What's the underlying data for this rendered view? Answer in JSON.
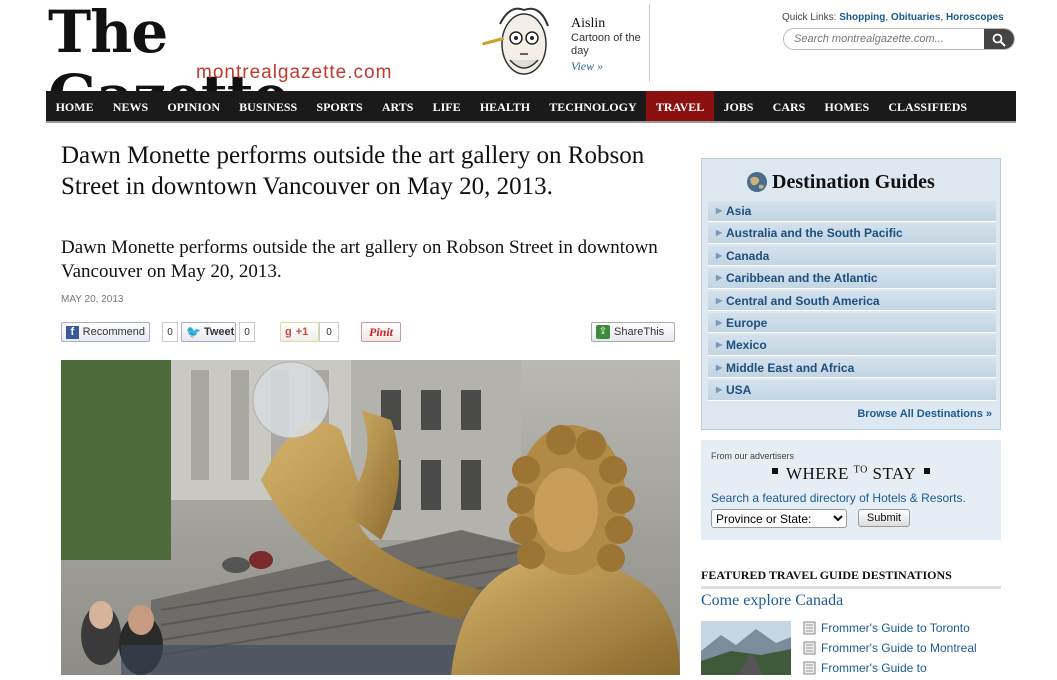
{
  "header": {
    "masthead": "The Gazette",
    "site_url": "montrealgazette.com",
    "cartoon": {
      "name": "Aislin",
      "subtitle": "Cartoon of the day",
      "view": "View »"
    },
    "quick_links": {
      "label": "Quick Links:",
      "links": [
        "Shopping",
        "Obituaries",
        "Horoscopes"
      ]
    },
    "search_placeholder": "Search montrealgazette.com..."
  },
  "nav": {
    "items": [
      "HOME",
      "NEWS",
      "OPINION",
      "BUSINESS",
      "SPORTS",
      "ARTS",
      "LIFE",
      "HEALTH",
      "TECHNOLOGY",
      "TRAVEL",
      "JOBS",
      "CARS",
      "HOMES",
      "CLASSIFIEDS"
    ],
    "active": "TRAVEL"
  },
  "article": {
    "headline": "Dawn Monette performs outside the art gallery on Robson Street in downtown Vancouver on May 20, 2013.",
    "deck": "Dawn Monette performs outside the art gallery on Robson Street in downtown Vancouver on May 20, 2013.",
    "date": "MAY 20, 2013",
    "share": {
      "recommend_label": "Recommend",
      "recommend_count": "0",
      "tweet_label": "Tweet",
      "tweet_count": "0",
      "gplus_label": "+1",
      "gplus_count": "0",
      "pin_label": "Pinit",
      "sharethis_label": "ShareThis"
    }
  },
  "sidebar": {
    "destinations": {
      "title": "Destination Guides",
      "items": [
        "Asia",
        "Australia and the South Pacific",
        "Canada",
        "Caribbean and the Atlantic",
        "Central and South America",
        "Europe",
        "Mexico",
        "Middle East and Africa",
        "USA"
      ],
      "browse": "Browse All Destinations »"
    },
    "where_to_stay": {
      "from": "From our advertisers",
      "title_a": "WHERE",
      "title_to": "TO",
      "title_b": "STAY",
      "desc": "Search a featured directory of Hotels & Resorts.",
      "select_value": "Province or State:",
      "submit": "Submit"
    },
    "featured": {
      "heading": "FEATURED TRAVEL GUIDE DESTINATIONS",
      "subheading": "Come explore Canada",
      "guides": [
        "Frommer's Guide to Toronto",
        "Frommer's Guide to Montreal",
        "Frommer's Guide to"
      ]
    }
  },
  "colors": {
    "nav_bg": "#1a1a1a",
    "nav_active": "#8b1010",
    "link": "#1d5b95",
    "url_red": "#c0392b"
  }
}
